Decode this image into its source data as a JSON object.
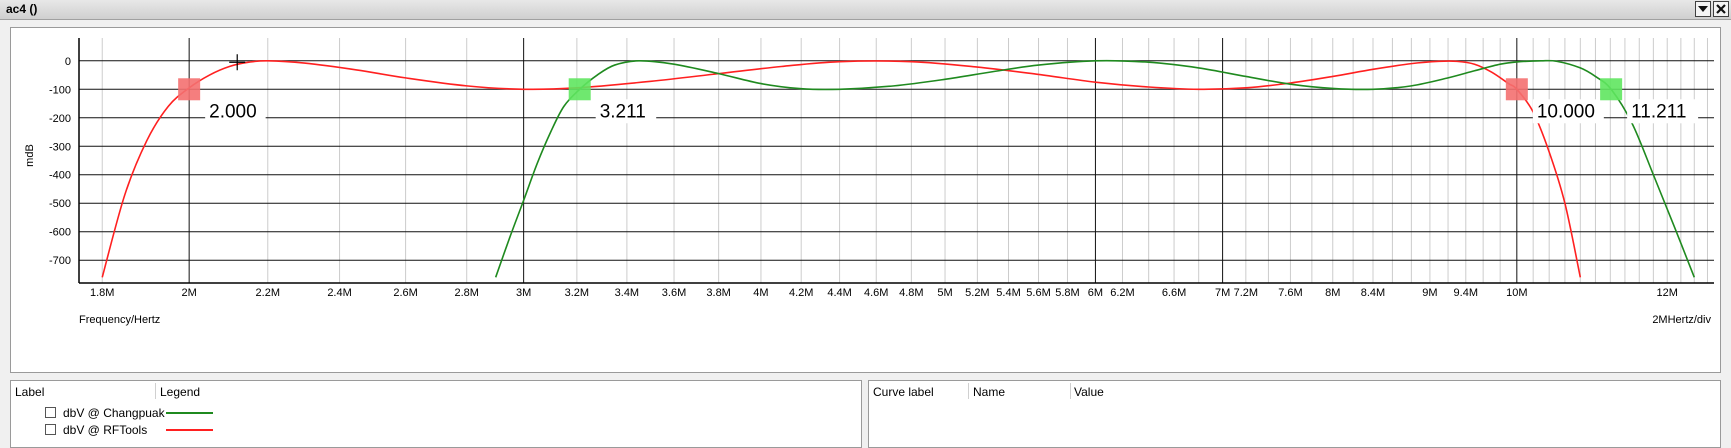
{
  "window": {
    "title": "ac4 ()"
  },
  "chart_data": {
    "type": "line",
    "title": "",
    "xlabel": "Frequency/Hertz",
    "x_scale_label": "2MHertz/div",
    "ylabel": "mdB",
    "x_scale": "log",
    "xlim": [
      1750000,
      12700000
    ],
    "ylim": [
      -780,
      80
    ],
    "grid": true,
    "legend_placement": "bottom-left panel",
    "y_ticks": [
      0,
      -100,
      -200,
      -300,
      -400,
      -500,
      -600,
      -700
    ],
    "y_tick_labels": [
      "0",
      "-100",
      "-200",
      "-300",
      "-400",
      "-500",
      "-600",
      "-700"
    ],
    "x_ticks": [
      1800000,
      2000000,
      2200000,
      2400000,
      2600000,
      2800000,
      3000000,
      3200000,
      3400000,
      3600000,
      3800000,
      4000000,
      4200000,
      4400000,
      4600000,
      4800000,
      5000000,
      5200000,
      5400000,
      5600000,
      5800000,
      6000000,
      6200000,
      6600000,
      7000000,
      7200000,
      7600000,
      8000000,
      8400000,
      9000000,
      9400000,
      10000000,
      12000000
    ],
    "x_tick_labels": [
      "1.8M",
      "2M",
      "2.2M",
      "2.4M",
      "2.6M",
      "2.8M",
      "3M",
      "3.2M",
      "3.4M",
      "3.6M",
      "3.8M",
      "4M",
      "4.2M",
      "4.4M",
      "4.6M",
      "4.8M",
      "5M",
      "5.2M",
      "5.4M",
      "5.6M",
      "5.8M",
      "6M",
      "6.2M",
      "6.6M",
      "7M",
      "7.2M",
      "7.6M",
      "8M",
      "8.4M",
      "9M",
      "9.4M",
      "10M",
      "12M"
    ],
    "series": [
      {
        "name": "dbV @ RFTools",
        "color": "#ff2020",
        "x": [
          1800000,
          1850000,
          1900000,
          1950000,
          2000000,
          2050000,
          2100000,
          2150000,
          2200000,
          2300000,
          2450000,
          2600000,
          2800000,
          3000000,
          3200000,
          3500000,
          3800000,
          4100000,
          4400000,
          4800000,
          5200000,
          5600000,
          6000000,
          6400000,
          6800000,
          7200000,
          7600000,
          8000000,
          8400000,
          8800000,
          9100000,
          9300000,
          9500000,
          9700000,
          9900000,
          10000000,
          10200000,
          10400000,
          10600000,
          10800000
        ],
        "y": [
          -760,
          -470,
          -280,
          -160,
          -95,
          -50,
          -20,
          -5,
          0,
          -8,
          -32,
          -60,
          -88,
          -100,
          -95,
          -72,
          -45,
          -20,
          -3,
          -3,
          -22,
          -48,
          -75,
          -92,
          -100,
          -95,
          -78,
          -55,
          -30,
          -10,
          -2,
          -2,
          -12,
          -40,
          -80,
          -100,
          -180,
          -320,
          -500,
          -760
        ]
      },
      {
        "name": "dbV @ Changpuak",
        "color": "#1f8a1f",
        "x": [
          2900000,
          2950000,
          3000000,
          3050000,
          3100000,
          3150000,
          3211000,
          3280000,
          3350000,
          3450000,
          3600000,
          3800000,
          4000000,
          4200000,
          4400000,
          4700000,
          5000000,
          5300000,
          5600000,
          6000000,
          6400000,
          6800000,
          7200000,
          7600000,
          8000000,
          8400000,
          8800000,
          9200000,
          9500000,
          9800000,
          10000000,
          10300000,
          10500000,
          10800000,
          11000000,
          11211000,
          11500000,
          11800000,
          12100000,
          12400000
        ],
        "y": [
          -760,
          -620,
          -490,
          -360,
          -250,
          -160,
          -100,
          -50,
          -15,
          0,
          -12,
          -45,
          -80,
          -98,
          -100,
          -88,
          -65,
          -38,
          -15,
          0,
          -5,
          -25,
          -55,
          -82,
          -97,
          -100,
          -88,
          -60,
          -35,
          -12,
          -4,
          0,
          -2,
          -25,
          -55,
          -100,
          -220,
          -400,
          -580,
          -760
        ]
      }
    ],
    "markers": [
      {
        "series": "dbV @ RFTools",
        "x": 2000000,
        "y": -100,
        "label": "2.000"
      },
      {
        "series": "dbV @ Changpuak",
        "x": 3211000,
        "y": -100,
        "label": "3.211"
      },
      {
        "series": "dbV @ RFTools",
        "x": 10000000,
        "y": -100,
        "label": "10.000"
      },
      {
        "series": "dbV @ Changpuak",
        "x": 11211000,
        "y": -100,
        "label": "11.211"
      }
    ]
  },
  "legend_panel": {
    "col_label": "Label",
    "col_legend": "Legend",
    "items": [
      {
        "label": "dbV @ Changpuak",
        "color": "#1f8a1f"
      },
      {
        "label": "dbV @ RFTools",
        "color": "#ff2020"
      }
    ]
  },
  "curve_panel": {
    "col_curve_label": "Curve label",
    "col_name": "Name",
    "col_value": "Value"
  }
}
